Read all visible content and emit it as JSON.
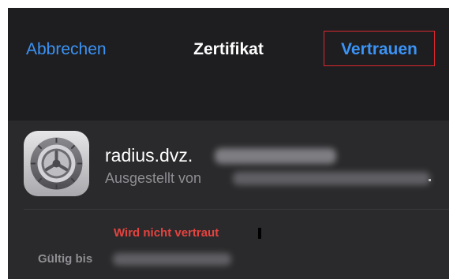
{
  "navbar": {
    "cancel_label": "Abbrechen",
    "title": "Zertifikat",
    "trust_label": "Vertrauen"
  },
  "certificate": {
    "icon": "settings-gear-icon",
    "name": "radius.dvz.",
    "issued_by_label": "Ausgestellt von",
    "trailing_dot": ".",
    "status": "Wird nicht vertraut",
    "valid_until_label": "Gültig bis"
  },
  "colors": {
    "background": "#1c1c1e",
    "accent_blue": "#3b93f6",
    "warning_red": "#e5433f",
    "highlight_border": "#d9282f"
  }
}
